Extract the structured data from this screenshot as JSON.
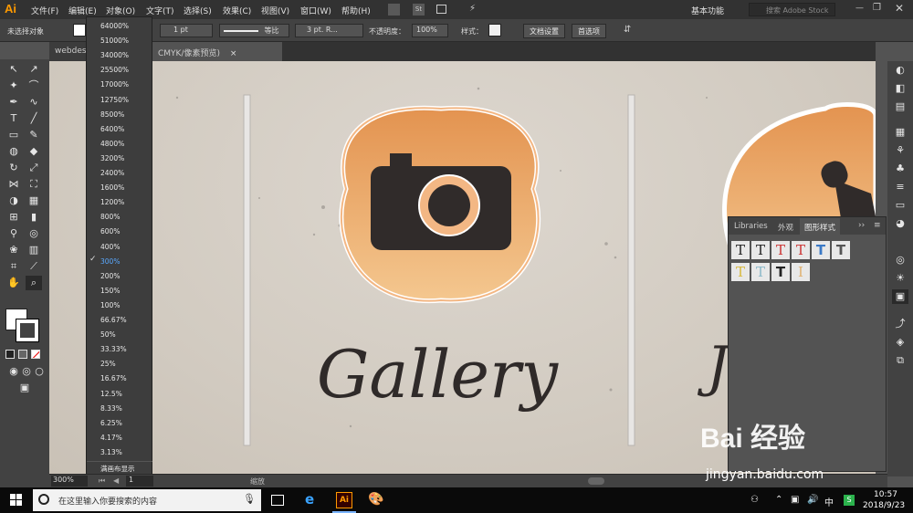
{
  "app": {
    "logo": "Ai"
  },
  "menu": [
    "文件(F)",
    "编辑(E)",
    "对象(O)",
    "文字(T)",
    "选择(S)",
    "效果(C)",
    "视图(V)",
    "窗口(W)",
    "帮助(H)"
  ],
  "workspace": {
    "label": "基本功能",
    "search_placeholder": "搜索 Adobe Stock"
  },
  "control": {
    "selection": "未选择对象",
    "stroke_weight": "1 pt",
    "stroke_profile": "等比",
    "brush": "3 pt. R...",
    "opacity_label": "不透明度：",
    "opacity": "100%",
    "style_label": "样式：",
    "doc_setup": "文档设置",
    "prefs": "首选项"
  },
  "tabs": [
    "webdes",
    "CMYK/像素预览)"
  ],
  "zoom_options": [
    "64000%",
    "51000%",
    "34000%",
    "25500%",
    "17000%",
    "12750%",
    "8500%",
    "6400%",
    "4800%",
    "3200%",
    "2400%",
    "1600%",
    "1200%",
    "800%",
    "600%",
    "400%",
    "300%",
    "200%",
    "150%",
    "100%",
    "66.67%",
    "50%",
    "33.33%",
    "25%",
    "16.67%",
    "12.5%",
    "8.33%",
    "6.25%",
    "4.17%",
    "3.13%"
  ],
  "zoom_selected": "300%",
  "zoom_footer": "满画布显示",
  "artwork": {
    "title": "Gallery"
  },
  "panel": {
    "tabs": [
      "Libraries",
      "外观",
      "图形样式"
    ]
  },
  "status": {
    "zoom": "300%",
    "page": "1",
    "tool": "缩放"
  },
  "taskbar": {
    "search_placeholder": "在这里输入你要搜索的内容",
    "time": "10:57",
    "date": "2018/9/23",
    "ai_label": "Ai"
  },
  "watermark": {
    "line1": "Bai 经验",
    "line2": "jingyan.baidu.com"
  },
  "colors": {
    "accent_orange": "#f0a060",
    "ai_orange": "#ff9a00"
  }
}
